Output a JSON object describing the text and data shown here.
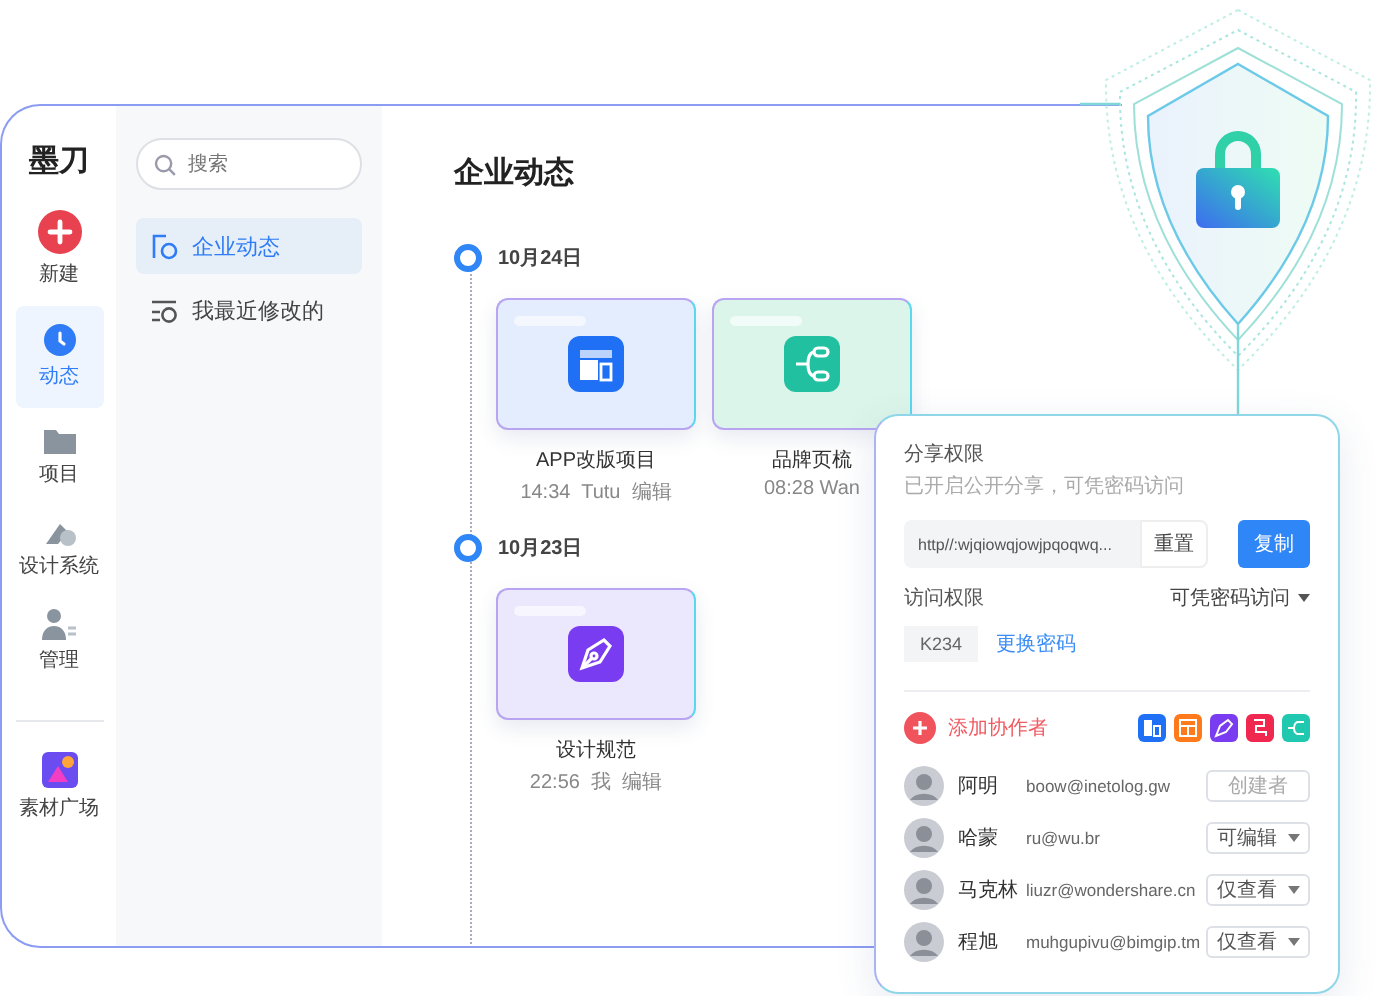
{
  "logo": "墨刀",
  "rail": [
    {
      "label": "新建",
      "kind": "new",
      "selected": false
    },
    {
      "label": "动态",
      "kind": "activity",
      "selected": true
    },
    {
      "label": "项目",
      "kind": "folder",
      "selected": false
    },
    {
      "label": "设计系统",
      "kind": "design",
      "selected": false
    },
    {
      "label": "管理",
      "kind": "people",
      "selected": false
    },
    {
      "label": "素材广场",
      "kind": "assets",
      "selected": false
    }
  ],
  "nav": {
    "search": {
      "placeholder": "搜索"
    },
    "items": [
      {
        "label": "企业动态",
        "kind": "feed",
        "selected": true
      },
      {
        "label": "我最近修改的",
        "kind": "recent",
        "selected": false
      }
    ]
  },
  "page_title": "企业动态",
  "timeline": [
    {
      "date": "10月24日",
      "projects": [
        {
          "name": "APP改版项目",
          "meta": "14:34  Tutu  编辑",
          "kind": "app"
        },
        {
          "name": "品牌页梳",
          "meta": "08:28 Wan",
          "kind": "flow"
        }
      ]
    },
    {
      "date": "10月23日",
      "projects": [
        {
          "name": "设计规范",
          "meta": "22:56  我  编辑",
          "kind": "pen"
        }
      ]
    }
  ],
  "share": {
    "title": "分享权限",
    "subtitle": "已开启公开分享，可凭密码访问",
    "link": "http//:wjqiowqjowjpqoqwq...",
    "reset": "重置",
    "copy": "复制",
    "access_label": "访问权限",
    "access_value": "可凭密码访问",
    "password": "K234",
    "change_password": "更换密码",
    "add_label": "添加协作者",
    "collaborators": [
      {
        "name": "阿明",
        "email": "boow@inetolog.gw",
        "role": "创建者",
        "disabled": true
      },
      {
        "name": "哈蒙",
        "email": "ru@wu.br",
        "role": "可编辑",
        "disabled": false
      },
      {
        "name": "马克林",
        "email": "liuzr@wondershare.cn",
        "role": "仅查看",
        "disabled": false
      },
      {
        "name": "程旭",
        "email": "muhgupivu@bimgip.tm",
        "role": "仅查看",
        "disabled": false
      }
    ]
  }
}
